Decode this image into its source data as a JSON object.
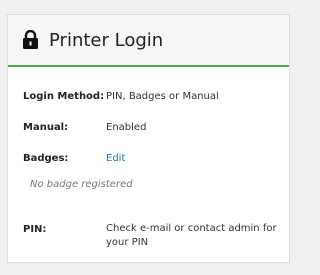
{
  "card": {
    "title": "Printer Login",
    "icon": "lock-icon"
  },
  "fields": {
    "login_method": {
      "label": "Login Method:",
      "value": "PIN, Badges or Manual"
    },
    "manual": {
      "label": "Manual:",
      "value": "Enabled"
    },
    "badges": {
      "label": "Badges:",
      "action": "Edit",
      "note": "No badge registered"
    },
    "pin": {
      "label": "PIN:",
      "value": "Check e-mail or contact admin for your PIN"
    }
  },
  "colors": {
    "accent_line": "#4caf50",
    "link": "#1a73c7"
  }
}
